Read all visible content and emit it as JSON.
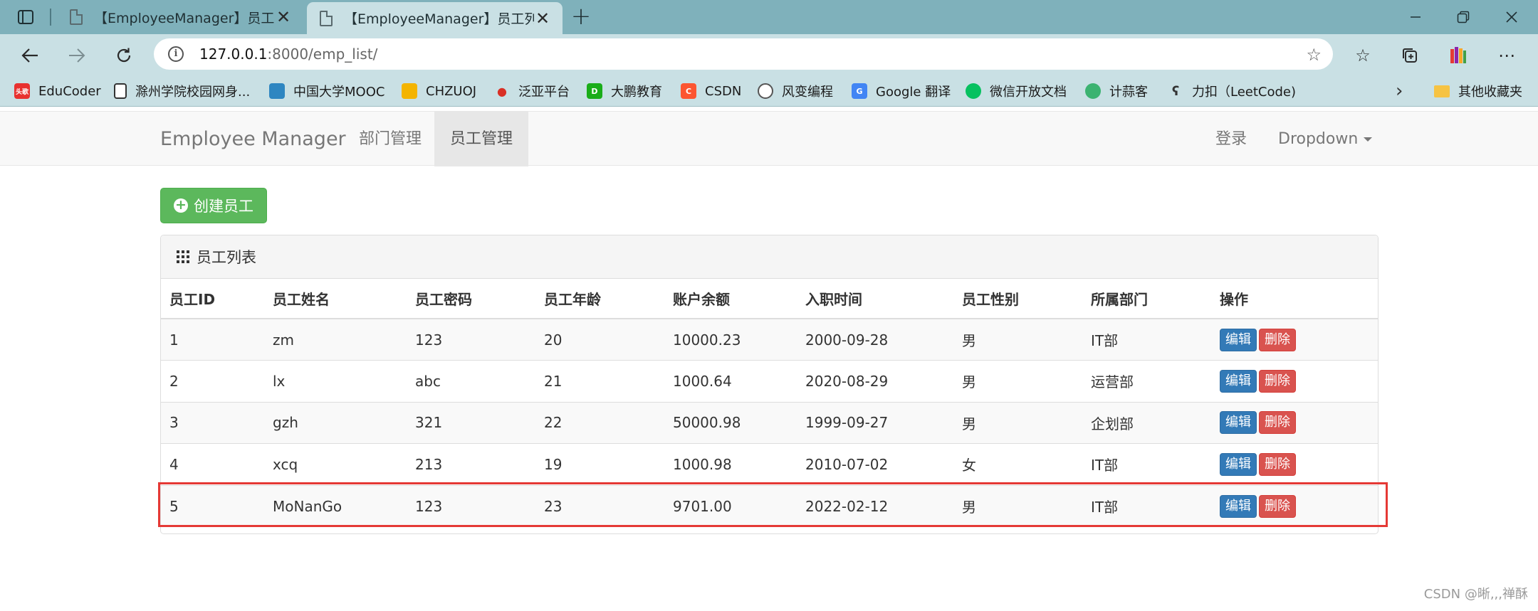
{
  "browser": {
    "tabs": [
      {
        "title": "【EmployeeManager】员工列表",
        "active": false
      },
      {
        "title": "【EmployeeManager】员工列表",
        "active": true
      }
    ],
    "close_symbol": "✕",
    "new_tab_symbol": "+",
    "url": {
      "host": "127.0.0.1",
      "path": ":8000/emp_list/"
    },
    "bookmarks": [
      {
        "label": "EduCoder",
        "icon": "educoder-icon",
        "color": "#e8312f",
        "badge": "头歌"
      },
      {
        "label": "滁州学院校园网身...",
        "icon": "page-icon",
        "color": "#ffffff",
        "badge": ""
      },
      {
        "label": "中国大学MOOC",
        "icon": "mooc-icon",
        "color": "#2e86c1",
        "badge": ""
      },
      {
        "label": "CHZUOJ",
        "icon": "chzuoj-icon",
        "color": "#f4b400",
        "badge": ""
      },
      {
        "label": "泛亚平台",
        "icon": "fanya-icon",
        "color": "#d93025",
        "badge": ""
      },
      {
        "label": "大鹏教育",
        "icon": "dapeng-icon",
        "color": "#1aad19",
        "badge": "D"
      },
      {
        "label": "CSDN",
        "icon": "csdn-icon",
        "color": "#fc5531",
        "badge": "C"
      },
      {
        "label": "风变编程",
        "icon": "panda-icon",
        "color": "#555555",
        "badge": ""
      },
      {
        "label": "Google 翻译",
        "icon": "google-translate-icon",
        "color": "#4285f4",
        "badge": "G"
      },
      {
        "label": "微信开放文档",
        "icon": "wechat-icon",
        "color": "#07c160",
        "badge": ""
      },
      {
        "label": "计蒜客",
        "icon": "jisuanke-icon",
        "color": "#3cb371",
        "badge": ""
      },
      {
        "label": "力扣（LeetCode)",
        "icon": "leetcode-icon",
        "color": "#333333",
        "badge": ""
      }
    ],
    "other_bookmarks": "其他收藏夹"
  },
  "navbar": {
    "brand": "Employee Manager",
    "links": [
      "部门管理",
      "员工管理"
    ],
    "active_link": "员工管理",
    "login": "登录",
    "dropdown": "Dropdown"
  },
  "create_button": "创建员工",
  "panel": {
    "title": "员工列表",
    "columns": [
      "员工ID",
      "员工姓名",
      "员工密码",
      "员工年龄",
      "账户余额",
      "入职时间",
      "员工性别",
      "所属部门",
      "操作"
    ],
    "rows": [
      [
        "1",
        "zm",
        "123",
        "20",
        "10000.23",
        "2000-09-28",
        "男",
        "IT部"
      ],
      [
        "2",
        "lx",
        "abc",
        "21",
        "1000.64",
        "2020-08-29",
        "男",
        "运营部"
      ],
      [
        "3",
        "gzh",
        "321",
        "22",
        "50000.98",
        "1999-09-27",
        "男",
        "企划部"
      ],
      [
        "4",
        "xcq",
        "213",
        "19",
        "1000.98",
        "2010-07-02",
        "女",
        "IT部"
      ],
      [
        "5",
        "MoNanGo",
        "123",
        "23",
        "9701.00",
        "2022-02-12",
        "男",
        "IT部"
      ]
    ],
    "edit_label": "编辑",
    "delete_label": "删除"
  },
  "watermark": "CSDN @晰,,,禅酥",
  "colors": {
    "success": "#5cb85c",
    "primary": "#337ab7",
    "danger": "#d9534f",
    "highlight": "#e53935",
    "tabbar": "#7fb1bb",
    "toolbar": "#c9e0e4"
  }
}
